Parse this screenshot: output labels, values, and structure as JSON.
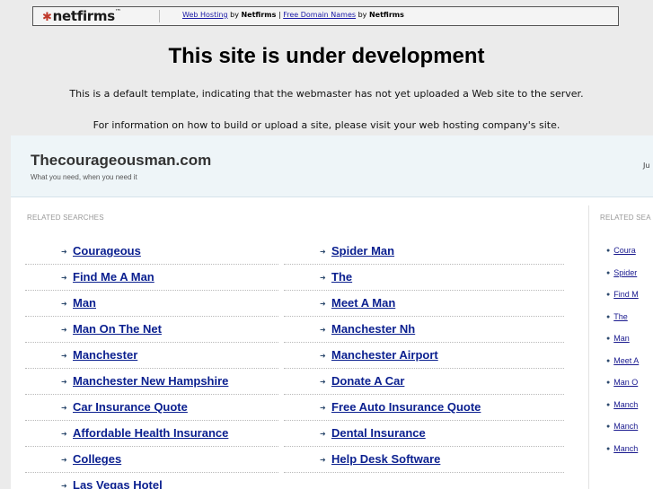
{
  "banner": {
    "logo_mark": "✱",
    "logo_text": "netfirms",
    "logo_tm": "™",
    "link1": "Web Hosting",
    "by1": " by ",
    "brand1": "Netfirms",
    "sep": " | ",
    "link2": "Free Domain Names",
    "by2": " by ",
    "brand2": "Netfirms"
  },
  "notice": {
    "headline": "This site is under development",
    "line1": "This is a default template, indicating that the webmaster has not yet uploaded a Web site to the server.",
    "line2": "For information on how to build or upload a site, please visit your web hosting company's site."
  },
  "site": {
    "title": "Thecourageousman.com",
    "tagline": "What you need, when you need it",
    "right_fragment": "Ju"
  },
  "related": {
    "label": "RELATED SEARCHES",
    "label_right": "RELATED SEA",
    "arrow": "➜",
    "left_column": [
      "Courageous",
      "Find Me A Man",
      "Man",
      "Man On The Net",
      "Manchester",
      "Manchester New Hampshire",
      "Car Insurance Quote",
      "Affordable Health Insurance",
      "Colleges",
      "Las Vegas Hotel"
    ],
    "right_column": [
      "Spider Man",
      "The",
      "Meet A Man",
      "Manchester Nh",
      "Manchester Airport",
      "Donate A Car",
      "Free Auto Insurance Quote",
      "Dental Insurance",
      "Help Desk Software"
    ],
    "sidebar": [
      "Coura",
      "Spider",
      "Find M",
      "The",
      "Man",
      "Meet A",
      "Man O",
      "Manch",
      "Manch",
      "Manch"
    ]
  }
}
